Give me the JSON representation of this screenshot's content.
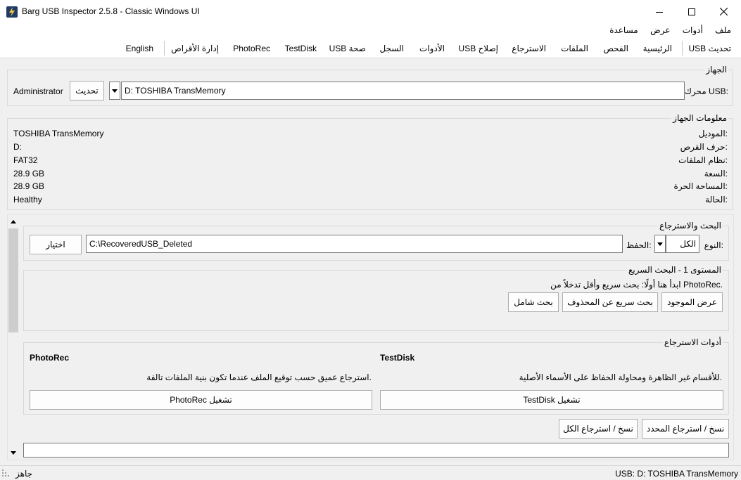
{
  "window": {
    "title": "Barg USB Inspector 2.5.8 - Classic Windows UI",
    "icon": "lightning-icon",
    "minimize_icon": "minimize-icon",
    "maximize_icon": "maximize-icon",
    "close_icon": "close-icon"
  },
  "menu": [
    "ملف",
    "أدوات",
    "عرض",
    "مساعدة"
  ],
  "tabs": [
    "USB تحديث",
    "الرئيسية",
    "الفحص",
    "الملفات",
    "الاسترجاع",
    "USB إصلاح",
    "الأدوات",
    "السجل",
    "USB صحة",
    "TestDisk",
    "PhotoRec",
    "إدارة الأقراص",
    "English"
  ],
  "device": {
    "group_title": "الجهاز",
    "usb_drive_label": "محرك USB:",
    "usb_drive_value": "D:  TOSHIBA TransMemory",
    "refresh_button": "تحديث",
    "admin_label": "Administrator"
  },
  "device_info": {
    "group_title": "معلومات الجهاز",
    "rows": [
      {
        "label": "الموديل:",
        "value": "TOSHIBA TransMemory"
      },
      {
        "label": "حرف القرص:",
        "value": "D:"
      },
      {
        "label": "نظام الملفات:",
        "value": "FAT32"
      },
      {
        "label": "السعة:",
        "value": "28.9 GB"
      },
      {
        "label": "المساحة الحرة:",
        "value": "28.9 GB"
      },
      {
        "label": "الحالة:",
        "value": "Healthy"
      }
    ]
  },
  "search": {
    "group_title": "البحث والاسترجاع",
    "type_label": "النوع:",
    "type_value": "الكل",
    "save_label": "الحفظ:",
    "save_path": "C:\\RecoveredUSB_Deleted",
    "choose_button": "اختيار"
  },
  "quick": {
    "group_title": "المستوى 1 - البحث السريع",
    "hint": "ابدأ هنا أولًا: بحث سريع وأقل تدخلاً من PhotoRec.",
    "show_existing_button": "عرض الموجود",
    "quick_deleted_button": "بحث سريع عن المحذوف",
    "full_search_button": "بحث شامل"
  },
  "recovery_tools": {
    "group_title": "أدوات الاسترجاع",
    "testdisk_title": "TestDisk",
    "testdisk_desc": "للأقسام غير الظاهرة ومحاولة الحفاظ على الأسماء الأصلية.",
    "testdisk_button": "TestDisk تشغيل",
    "photorec_title": "PhotoRec",
    "photorec_desc": "استرجاع عميق حسب توقيع الملف عندما تكون بنية الملفات تالفة.",
    "photorec_button": "PhotoRec تشغيل"
  },
  "actions": {
    "copy_selected": "نسخ / استرجاع المحدد",
    "copy_all": "نسخ / استرجاع الكل"
  },
  "status": {
    "left": "جاهز",
    "right": "USB: D: TOSHIBA TransMemory"
  }
}
